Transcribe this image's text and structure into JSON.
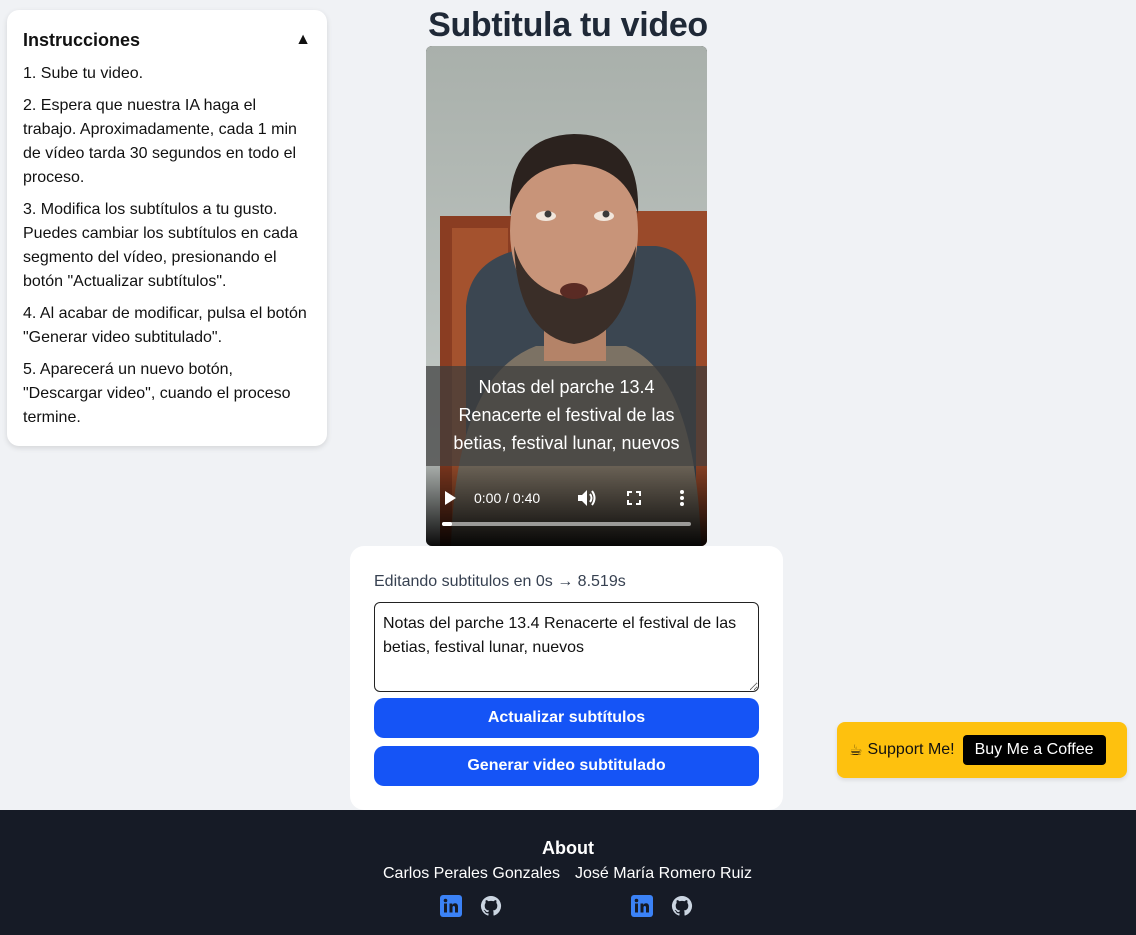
{
  "page": {
    "title": "Subtitula tu video"
  },
  "instructions": {
    "title": "Instrucciones",
    "toggle_symbol": "▲",
    "steps": [
      "1. Sube tu video.",
      "2. Espera que nuestra IA haga el trabajo. Aproximadamente, cada 1 min de vídeo tarda 30 segundos en todo el proceso.",
      "3. Modifica los subtítulos a tu gusto. Puedes cambiar los subtítulos en cada segmento del vídeo, presionando el botón \"Actualizar subtítulos\".",
      "4. Al acabar de modificar, pulsa el botón \"Generar video subtitulado\".",
      "5. Aparecerá un nuevo botón, \"Descargar video\", cuando el proceso termine."
    ]
  },
  "video": {
    "subtitle": "Notas del parche 13.4 Renacerte el festival de las betias, festival lunar, nuevos",
    "time": "0:00 / 0:40",
    "progress_fraction": 0.04
  },
  "editor": {
    "label": "Editando subtitulos en 0s → 8.519s",
    "textarea_value": "Notas del parche 13.4 Renacerte el festival de las betias, festival lunar, nuevos",
    "update_button": "Actualizar subtítulos",
    "generate_button": "Generar video subtitulado"
  },
  "support": {
    "icon": "☕",
    "label": "Support Me!",
    "button": "Buy Me a Coffee"
  },
  "footer": {
    "title": "About",
    "authors": [
      "Carlos Perales Gonzales",
      "José María Romero Ruiz"
    ]
  },
  "colors": {
    "primary_button": "#1554f6",
    "support_bg": "#fec10e",
    "footer_bg": "#161b26",
    "linkedin": "#3b82f6"
  }
}
